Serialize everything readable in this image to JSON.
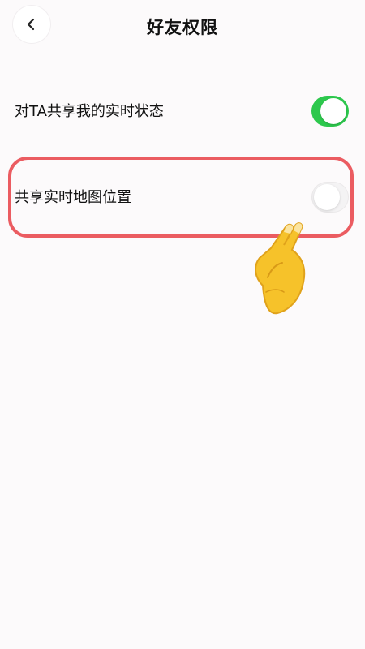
{
  "header": {
    "title": "好友权限",
    "back_icon": "chevron-left-icon"
  },
  "settings": [
    {
      "label": "对TA共享我的实时状态",
      "enabled": true
    },
    {
      "label": "共享实时地图位置",
      "enabled": false
    }
  ],
  "colors": {
    "toggle_on": "#2dc84d",
    "highlight": "#eb5c61",
    "background": "#fcfafb"
  }
}
